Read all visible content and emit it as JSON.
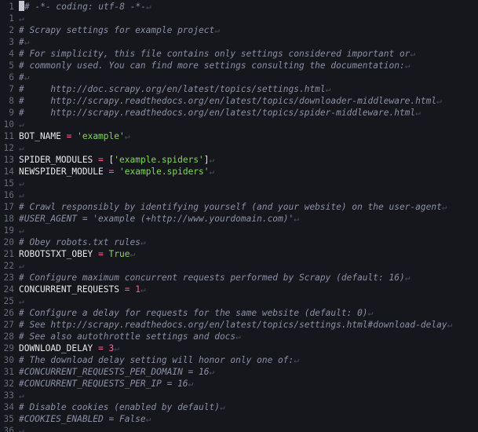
{
  "editor": {
    "eol_marker": "↵",
    "lines": [
      {
        "n": "1",
        "tokens": [
          {
            "t": "cursor",
            "v": ""
          },
          {
            "t": "comment",
            "v": "# -*- coding: utf-8 -*-"
          }
        ]
      },
      {
        "n": "1",
        "tokens": []
      },
      {
        "n": "2",
        "tokens": [
          {
            "t": "comment",
            "v": "# Scrapy settings for example project"
          }
        ]
      },
      {
        "n": "3",
        "tokens": [
          {
            "t": "comment",
            "v": "#"
          }
        ]
      },
      {
        "n": "4",
        "tokens": [
          {
            "t": "comment",
            "v": "# For simplicity, this file contains only settings considered important or"
          }
        ]
      },
      {
        "n": "5",
        "tokens": [
          {
            "t": "comment",
            "v": "# commonly used. You can find more settings consulting the documentation:"
          }
        ]
      },
      {
        "n": "6",
        "tokens": [
          {
            "t": "comment",
            "v": "#"
          }
        ]
      },
      {
        "n": "7",
        "tokens": [
          {
            "t": "comment",
            "v": "#     http://doc.scrapy.org/en/latest/topics/settings.html"
          }
        ]
      },
      {
        "n": "8",
        "tokens": [
          {
            "t": "comment",
            "v": "#     http://scrapy.readthedocs.org/en/latest/topics/downloader-middleware.html"
          }
        ]
      },
      {
        "n": "9",
        "tokens": [
          {
            "t": "comment",
            "v": "#     http://scrapy.readthedocs.org/en/latest/topics/spider-middleware.html"
          }
        ]
      },
      {
        "n": "10",
        "tokens": []
      },
      {
        "n": "11",
        "tokens": [
          {
            "t": "plain",
            "v": "BOT_NAME "
          },
          {
            "t": "op",
            "v": "="
          },
          {
            "t": "plain",
            "v": " "
          },
          {
            "t": "str",
            "v": "'example'"
          }
        ]
      },
      {
        "n": "12",
        "tokens": []
      },
      {
        "n": "13",
        "tokens": [
          {
            "t": "plain",
            "v": "SPIDER_MODULES "
          },
          {
            "t": "op",
            "v": "="
          },
          {
            "t": "plain",
            "v": " ["
          },
          {
            "t": "str",
            "v": "'example.spiders'"
          },
          {
            "t": "plain",
            "v": "]"
          }
        ]
      },
      {
        "n": "14",
        "tokens": [
          {
            "t": "plain",
            "v": "NEWSPIDER_MODULE "
          },
          {
            "t": "op",
            "v": "="
          },
          {
            "t": "plain",
            "v": " "
          },
          {
            "t": "str",
            "v": "'example.spiders'"
          }
        ]
      },
      {
        "n": "15",
        "tokens": []
      },
      {
        "n": "16",
        "tokens": []
      },
      {
        "n": "17",
        "tokens": [
          {
            "t": "comment",
            "v": "# Crawl responsibly by identifying yourself (and your website) on the user-agent"
          }
        ]
      },
      {
        "n": "18",
        "tokens": [
          {
            "t": "comment",
            "v": "#USER_AGENT = 'example (+http://www.yourdomain.com)'"
          }
        ]
      },
      {
        "n": "19",
        "tokens": []
      },
      {
        "n": "20",
        "tokens": [
          {
            "t": "comment",
            "v": "# Obey robots.txt rules"
          }
        ]
      },
      {
        "n": "21",
        "tokens": [
          {
            "t": "plain",
            "v": "ROBOTSTXT_OBEY "
          },
          {
            "t": "op",
            "v": "="
          },
          {
            "t": "plain",
            "v": " "
          },
          {
            "t": "kw",
            "v": "True"
          }
        ]
      },
      {
        "n": "22",
        "tokens": []
      },
      {
        "n": "23",
        "tokens": [
          {
            "t": "comment",
            "v": "# Configure maximum concurrent requests performed by Scrapy (default: 16)"
          }
        ]
      },
      {
        "n": "24",
        "tokens": [
          {
            "t": "plain",
            "v": "CONCURRENT_REQUESTS "
          },
          {
            "t": "op",
            "v": "="
          },
          {
            "t": "plain",
            "v": " "
          },
          {
            "t": "num",
            "v": "1"
          }
        ]
      },
      {
        "n": "25",
        "tokens": []
      },
      {
        "n": "26",
        "tokens": [
          {
            "t": "comment",
            "v": "# Configure a delay for requests for the same website (default: 0)"
          }
        ]
      },
      {
        "n": "27",
        "tokens": [
          {
            "t": "comment",
            "v": "# See http://scrapy.readthedocs.org/en/latest/topics/settings.html#download-delay"
          }
        ]
      },
      {
        "n": "28",
        "tokens": [
          {
            "t": "comment",
            "v": "# See also autothrottle settings and docs"
          }
        ]
      },
      {
        "n": "29",
        "tokens": [
          {
            "t": "plain",
            "v": "DOWNLOAD_DELAY "
          },
          {
            "t": "op",
            "v": "="
          },
          {
            "t": "plain",
            "v": " "
          },
          {
            "t": "num",
            "v": "3"
          }
        ]
      },
      {
        "n": "30",
        "tokens": [
          {
            "t": "comment",
            "v": "# The download delay setting will honor only one of:"
          }
        ]
      },
      {
        "n": "31",
        "tokens": [
          {
            "t": "comment",
            "v": "#CONCURRENT_REQUESTS_PER_DOMAIN = 16"
          }
        ]
      },
      {
        "n": "32",
        "tokens": [
          {
            "t": "comment",
            "v": "#CONCURRENT_REQUESTS_PER_IP = 16"
          }
        ]
      },
      {
        "n": "33",
        "tokens": []
      },
      {
        "n": "34",
        "tokens": [
          {
            "t": "comment",
            "v": "# Disable cookies (enabled by default)"
          }
        ]
      },
      {
        "n": "35",
        "tokens": [
          {
            "t": "comment",
            "v": "#COOKIES_ENABLED = False"
          }
        ]
      },
      {
        "n": "36",
        "tokens": []
      }
    ]
  }
}
